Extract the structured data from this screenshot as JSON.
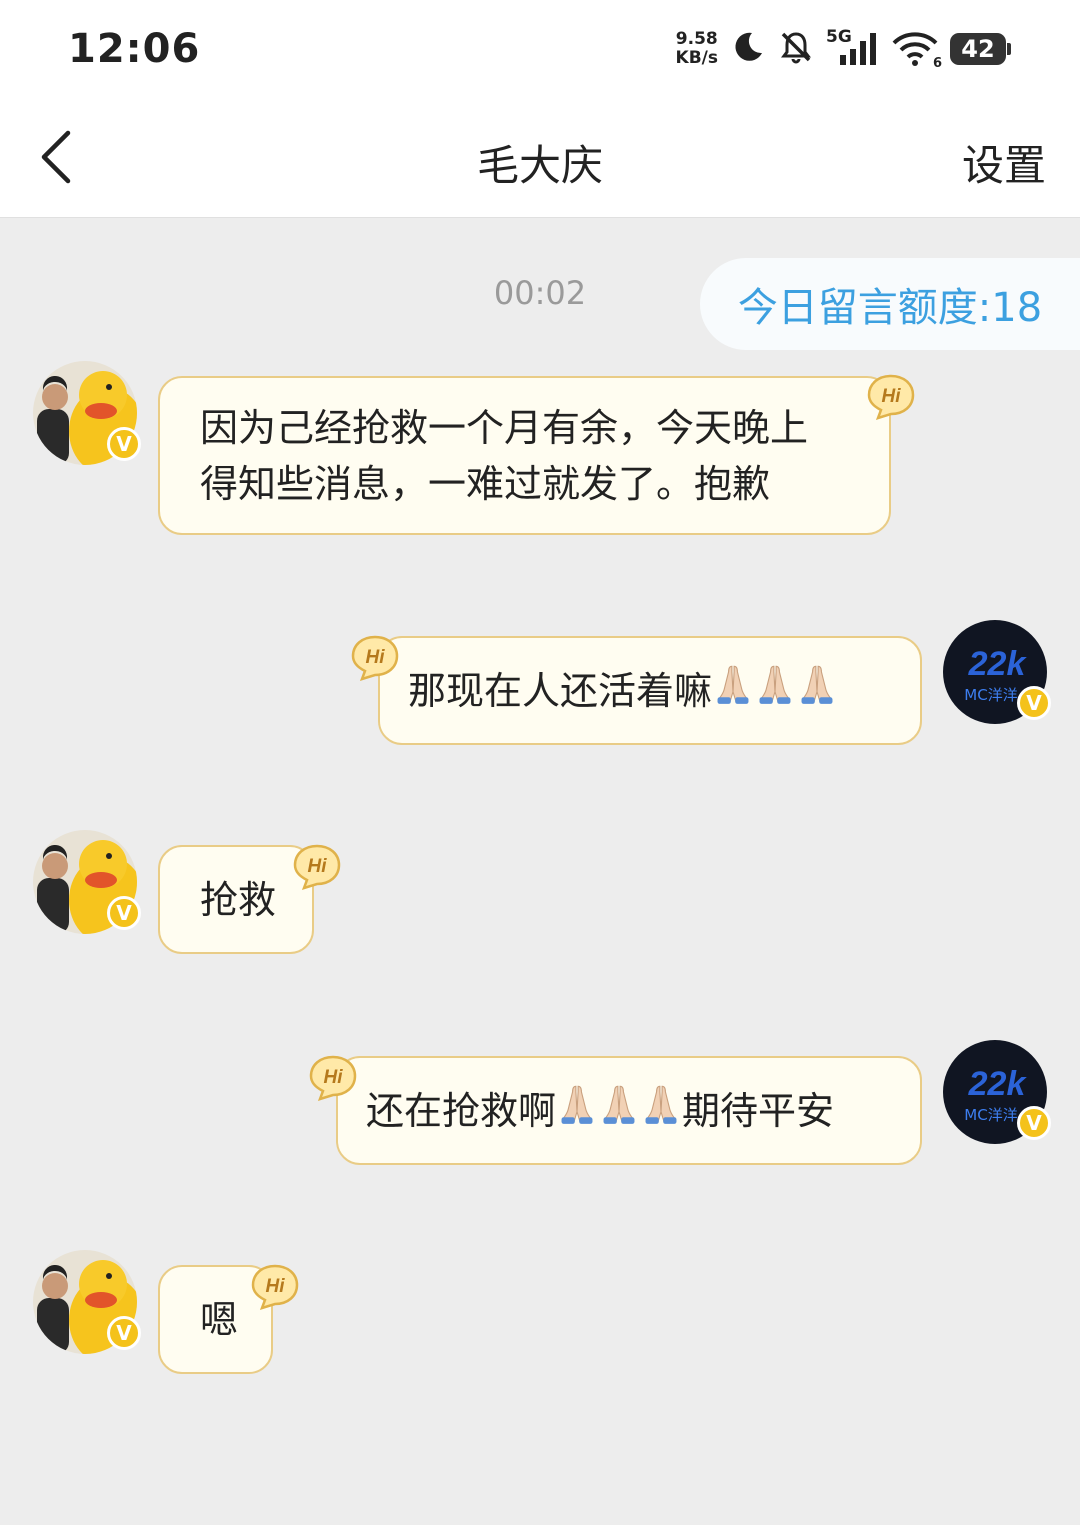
{
  "status_bar": {
    "time": "12:06",
    "net_speed_value": "9.58",
    "net_speed_unit": "KB/s",
    "network_type": "5G",
    "wifi_level": "6",
    "battery": "42"
  },
  "nav": {
    "title": "毛大庆",
    "settings_label": "设置"
  },
  "chat": {
    "timestamp": "00:02",
    "quota_label": "今日留言额度:18",
    "hi_badge": "Hi",
    "messages": [
      {
        "from": "other",
        "text": "因为己经抢救一个月有余，今天晚上\n得知些消息，一难过就发了。抱歉"
      },
      {
        "from": "self",
        "text_before": "那现在人还活着嘛",
        "emoji_count": 3,
        "text_after": ""
      },
      {
        "from": "other",
        "text": "抢救"
      },
      {
        "from": "self",
        "text_before": "还在抢救啊",
        "emoji_count": 3,
        "text_after": "期待平安"
      },
      {
        "from": "other",
        "text": "嗯"
      }
    ],
    "self_avatar_text": "MC洋洋"
  },
  "colors": {
    "bubble_bg": "#fffdf1",
    "bubble_border": "#e9cc86",
    "quota_text": "#3ca0e0",
    "verified_badge": "#f4c21b"
  }
}
